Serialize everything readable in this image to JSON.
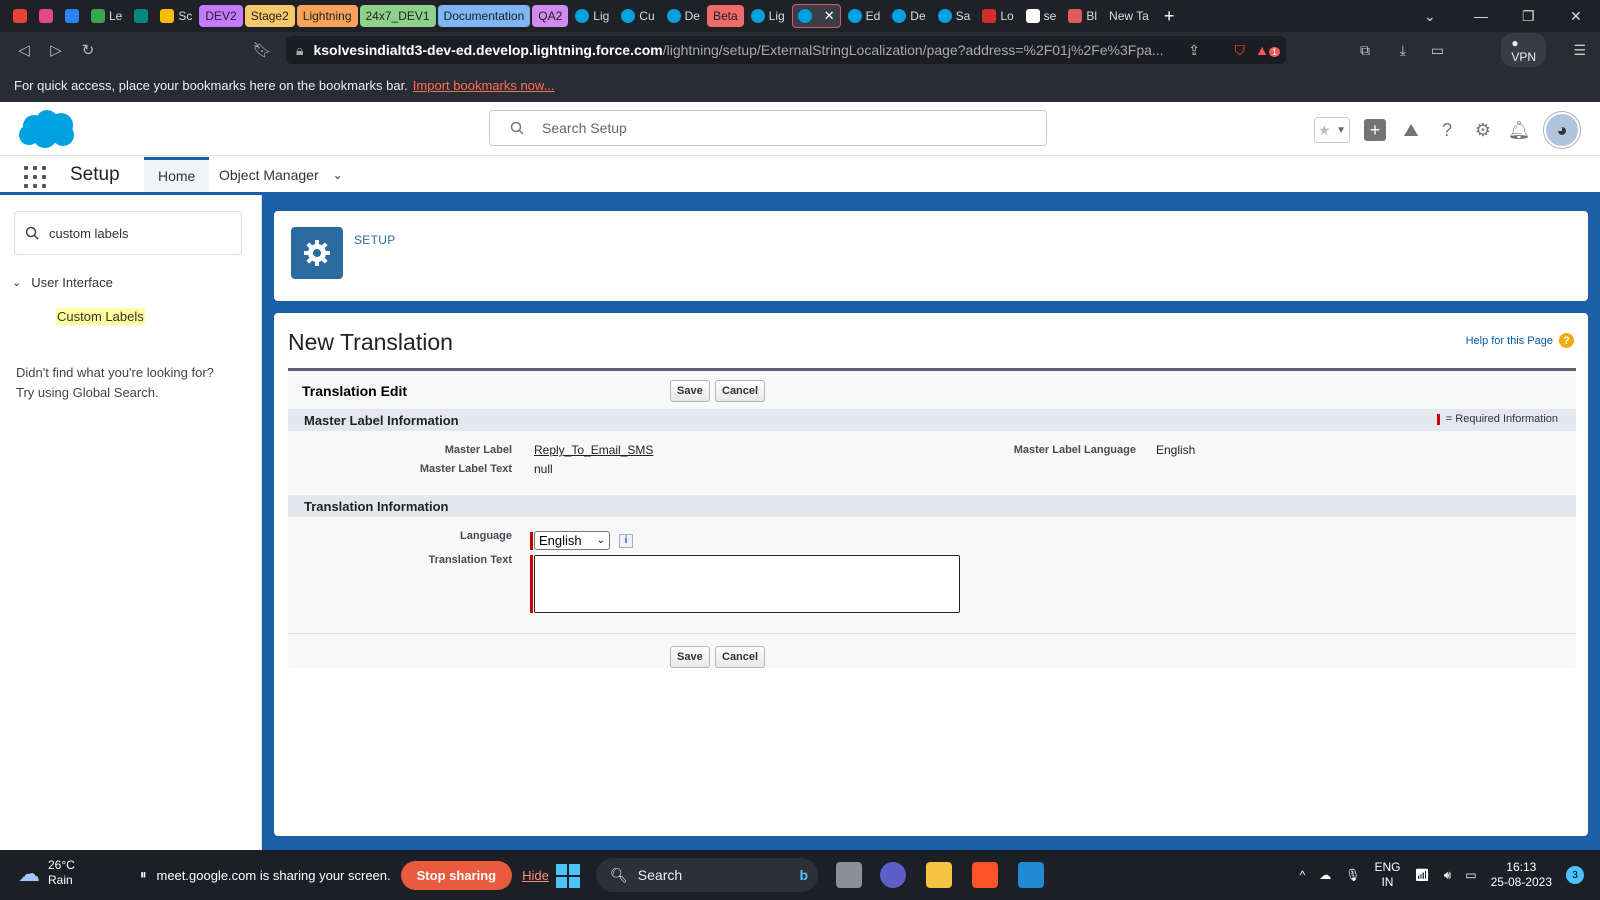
{
  "browser": {
    "tabs": [
      {
        "label": "",
        "icon": "gmail-icon",
        "color": "#ea4335",
        "style": "icon"
      },
      {
        "label": "",
        "icon": "circle-icon",
        "color": "#e04a8a",
        "style": "icon"
      },
      {
        "label": "",
        "icon": "jira-icon",
        "color": "#2684ff",
        "style": "icon"
      },
      {
        "label": "Le",
        "icon": "drive-icon",
        "color": "#34a853",
        "style": "icon"
      },
      {
        "label": "",
        "icon": "meet-icon",
        "color": "#00897b",
        "style": "icon"
      },
      {
        "label": "Sc",
        "icon": "drive-icon",
        "color": "#fbbc04",
        "style": "icon"
      },
      {
        "label": "DEV2",
        "color": "#c27bff",
        "style": "pill"
      },
      {
        "label": "Stage2",
        "color": "#f7c86b",
        "style": "pill"
      },
      {
        "label": "Lightning",
        "color": "#f7a35c",
        "style": "pill"
      },
      {
        "label": "24x7_DEV1",
        "color": "#8fd18b",
        "style": "pill"
      },
      {
        "label": "Documentation",
        "color": "#7fb6f5",
        "style": "pill"
      },
      {
        "label": "QA2",
        "color": "#d08bf0",
        "style": "pill"
      },
      {
        "label": "Lig",
        "icon": "salesforce-icon",
        "color": "#00a1e0",
        "style": "icon"
      },
      {
        "label": "Cu",
        "icon": "salesforce-icon",
        "color": "#00a1e0",
        "style": "icon"
      },
      {
        "label": "De",
        "icon": "salesforce-icon",
        "color": "#00a1e0",
        "style": "icon"
      },
      {
        "label": "Beta",
        "color": "#ef6b6b",
        "style": "pill"
      },
      {
        "label": "Lig",
        "icon": "salesforce-icon",
        "color": "#00a1e0",
        "style": "icon"
      },
      {
        "label": "",
        "icon": "salesforce-icon",
        "color": "#00a1e0",
        "style": "active"
      },
      {
        "label": "Ed",
        "icon": "salesforce-icon",
        "color": "#00a1e0",
        "style": "icon"
      },
      {
        "label": "De",
        "icon": "salesforce-icon",
        "color": "#00a1e0",
        "style": "icon"
      },
      {
        "label": "Sa",
        "icon": "salesforce-icon",
        "color": "#00a1e0",
        "style": "icon"
      },
      {
        "label": "Lo",
        "icon": "lastpass-icon",
        "color": "#d32d27",
        "style": "icon"
      },
      {
        "label": "se",
        "icon": "github-icon",
        "color": "#ffffff",
        "style": "icon"
      },
      {
        "label": "Bl",
        "icon": "bookmark-icon",
        "color": "#e05a5a",
        "style": "icon"
      },
      {
        "label": "New Ta",
        "icon": "",
        "color": "",
        "style": "plain"
      }
    ],
    "url_host": "ksolvesindialtd3-dev-ed.develop.lightning.force.com",
    "url_path": "/lightning/setup/ExternalStringLocalization/page?address=%2F01j%2Fe%3Fpa...",
    "vpn_label": "VPN",
    "brave_badge": "1",
    "bookmarks_hint": "For quick access, place your bookmarks here on the bookmarks bar.",
    "bookmarks_link": "Import bookmarks now..."
  },
  "sf_header": {
    "search_placeholder": "Search Setup"
  },
  "setup_nav": {
    "title": "Setup",
    "tabs": [
      "Home",
      "Object Manager"
    ]
  },
  "sidebar": {
    "search_value": "custom labels",
    "group": "User Interface",
    "item": "Custom Labels",
    "not_found_line1": "Didn't find what you're looking for?",
    "not_found_line2": "Try using Global Search."
  },
  "setup_card": {
    "label": "SETUP"
  },
  "page": {
    "title": "New Translation",
    "help": "Help for this Page",
    "form_title": "Translation Edit",
    "save": "Save",
    "cancel": "Cancel",
    "section_master": "Master Label Information",
    "required_legend": "= Required Information",
    "master_label_label": "Master Label",
    "master_label_value": "Reply_To_Email_SMS",
    "master_label_text_label": "Master Label Text",
    "master_label_text_value": "null",
    "master_label_language_label": "Master Label Language",
    "master_label_language_value": "English",
    "section_translation": "Translation Information",
    "language_label": "Language",
    "language_value": "English",
    "translation_text_label": "Translation Text",
    "translation_text_value": ""
  },
  "taskbar": {
    "temp": "26°C",
    "weather": "Rain",
    "share_text": "meet.google.com is sharing your screen.",
    "stop_sharing": "Stop sharing",
    "hide": "Hide",
    "search": "Search",
    "lang_top": "ENG",
    "lang_bottom": "IN",
    "time": "16:13",
    "date": "25-08-2023",
    "notif_count": "3"
  }
}
